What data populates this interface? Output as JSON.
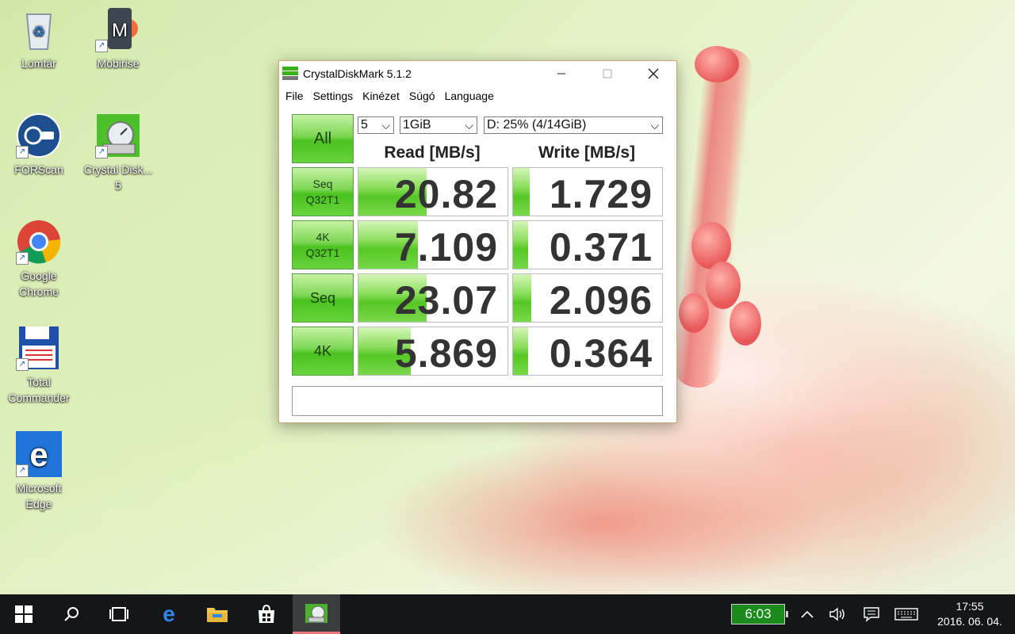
{
  "desktop": {
    "icons": [
      {
        "label": "Lomtár"
      },
      {
        "label": "Mobirise"
      },
      {
        "label": "FORScan"
      },
      {
        "label": "Crystal Disk..."
      },
      {
        "label": "5"
      },
      {
        "label": "Google Chrome"
      },
      {
        "label": "Total Commander"
      },
      {
        "label": "Microsoft Edge"
      }
    ]
  },
  "window": {
    "title": "CrystalDiskMark 5.1.2",
    "menu": [
      "File",
      "Settings",
      "Kinézet",
      "Súgó",
      "Language"
    ],
    "all_button": "All",
    "count_select": "5",
    "size_select": "1GiB",
    "drive_select": "D: 25% (4/14GiB)",
    "read_header": "Read [MB/s]",
    "write_header": "Write [MB/s]",
    "tests": [
      {
        "line1": "Seq",
        "line2": "Q32T1",
        "read": "20.82",
        "write": "1.729",
        "read_fill": 0.46,
        "write_fill": 0.11
      },
      {
        "line1": "4K",
        "line2": "Q32T1",
        "read": "7.109",
        "write": "0.371",
        "read_fill": 0.4,
        "write_fill": 0.1
      },
      {
        "line1": "Seq",
        "line2": "",
        "read": "23.07",
        "write": "2.096",
        "read_fill": 0.46,
        "write_fill": 0.12
      },
      {
        "line1": "4K",
        "line2": "",
        "read": "5.869",
        "write": "0.364",
        "read_fill": 0.35,
        "write_fill": 0.1
      }
    ],
    "comment": ""
  },
  "taskbar": {
    "battery_time": "6:03",
    "clock_time": "17:55",
    "clock_date": "2016. 06. 04."
  }
}
